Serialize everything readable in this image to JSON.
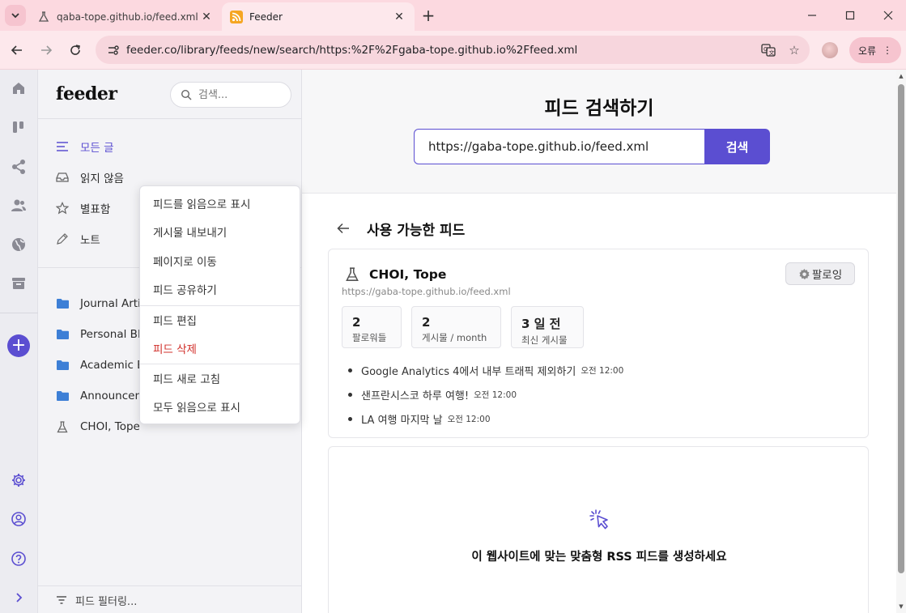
{
  "browser": {
    "tabs": [
      {
        "title": "qaba-tope.github.io/feed.xml",
        "active": false
      },
      {
        "title": "Feeder",
        "active": true
      }
    ],
    "url": "feeder.co/library/feeds/new/search/https:%2F%2Fgaba-tope.github.io%2Ffeed.xml",
    "error_label": "오류"
  },
  "sidebar": {
    "logo": "feeder",
    "search_placeholder": "검색...",
    "nav": [
      {
        "label": "모든 글",
        "icon": "list-icon",
        "active": true
      },
      {
        "label": "읽지 않음",
        "icon": "inbox-icon",
        "active": false
      },
      {
        "label": "별표함",
        "icon": "star-icon",
        "active": false
      },
      {
        "label": "노트",
        "icon": "pencil-icon",
        "active": false
      }
    ],
    "folders": [
      {
        "label": "Journal Arti",
        "icon": "folder-icon"
      },
      {
        "label": "Personal Bl",
        "icon": "folder-icon"
      },
      {
        "label": "Academic E",
        "icon": "folder-icon"
      },
      {
        "label": "Announcen",
        "icon": "folder-icon"
      },
      {
        "label": "CHOI, Tope",
        "icon": "flask-icon"
      }
    ],
    "filter_label": "피드 필터링..."
  },
  "context_menu": {
    "items": [
      {
        "label": "피드를 읽음으로 표시",
        "danger": false
      },
      {
        "label": "게시물 내보내기",
        "danger": false
      },
      {
        "label": "페이지로 이동",
        "danger": false
      },
      {
        "label": "피드 공유하기",
        "danger": false
      },
      {
        "label": "피드 편집",
        "danger": false
      },
      {
        "label": "피드 삭제",
        "danger": true
      },
      {
        "label": "피드 새로 고침",
        "danger": false
      },
      {
        "label": "모두 읽음으로 표시",
        "danger": false
      }
    ]
  },
  "main": {
    "title": "피드 검색하기",
    "search_value": "https://gaba-tope.github.io/feed.xml",
    "search_button": "검색",
    "results_title": "사용 가능한 피드",
    "feed": {
      "name": "CHOI, Tope",
      "url": "https://gaba-tope.github.io/feed.xml",
      "follow_label": "팔로잉",
      "stats": [
        {
          "value": "2",
          "label": "팔로워들"
        },
        {
          "value": "2",
          "label": "게시물 / month"
        },
        {
          "value": "3 일 전",
          "label": "최신 게시물"
        }
      ],
      "posts": [
        {
          "title": "Google Analytics 4에서 내부 트래픽 제외하기",
          "time": "오전 12:00"
        },
        {
          "title": "샌프란시스코 하루 여행!",
          "time": "오전 12:00"
        },
        {
          "title": "LA 여행 마지막 날",
          "time": "오전 12:00"
        }
      ]
    },
    "custom_feed_text": "이 웹사이트에 맞는 맞춤형 RSS 피드를 생성하세요"
  },
  "colors": {
    "accent": "#5b4ed1",
    "danger": "#d1302b",
    "folder": "#3d7fd6",
    "tabstrip": "#fcd9e0"
  }
}
